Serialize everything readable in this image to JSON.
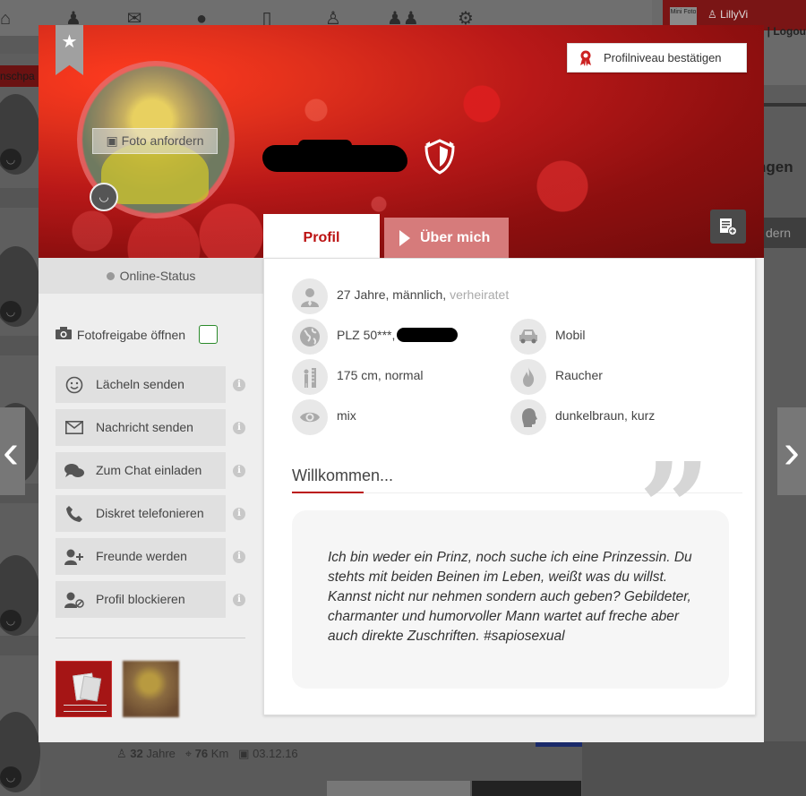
{
  "background": {
    "user_name": "LillyVi",
    "logout": "o | Logou",
    "mini_badge": "Mini Foto",
    "left_tab": "nschpa",
    "right_heading": "ngen",
    "right_button": "dern",
    "stats": {
      "age": "32",
      "age_unit": "Jahre",
      "distance": "76",
      "distance_unit": "Km",
      "date": "03.12.16"
    }
  },
  "header": {
    "photo_request": "Foto anfordern",
    "verify_button": "Profilniveau bestätigen"
  },
  "tabs": {
    "profil": "Profil",
    "ueber_mich": "Über mich"
  },
  "sidebar": {
    "online_status": "Online-Status",
    "foto_freigabe": "Fotofreigabe öffnen",
    "actions": [
      {
        "label": "Lächeln senden"
      },
      {
        "label": "Nachricht senden"
      },
      {
        "label": "Zum Chat einladen"
      },
      {
        "label": "Diskret telefonieren"
      },
      {
        "label": "Freunde werden"
      },
      {
        "label": "Profil blockieren"
      }
    ]
  },
  "profile": {
    "age_gender": "27 Jahre, männlich,",
    "status": "verheiratet",
    "plz": "PLZ 50***,",
    "height": "175 cm, normal",
    "eyes": "mix",
    "mobility": "Mobil",
    "smoker": "Raucher",
    "hair": "dunkelbraun, kurz"
  },
  "welcome": {
    "title": "Willkommen...",
    "text": "Ich bin weder ein Prinz, noch suche ich eine Prinzessin. Du stehts mit beiden Beinen im Leben, weißt was du willst. Kannst nicht nur nehmen sondern auch geben? Gebildeter, charmanter und humorvoller Mann wartet auf freche aber auch direkte Zuschriften. #sapiosexual"
  },
  "colors": {
    "accent": "#bb1111",
    "header_dark": "#6e0b0b",
    "tab_inactive": "#d67b7b"
  }
}
